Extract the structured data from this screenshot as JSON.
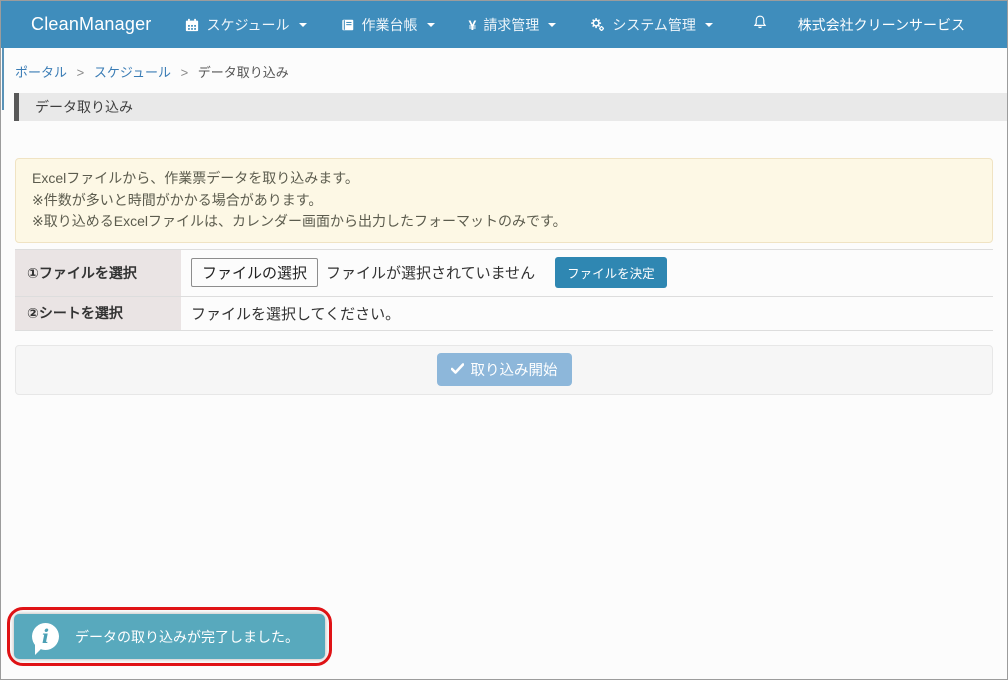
{
  "navbar": {
    "brand": "CleanManager",
    "menus": [
      {
        "label": "スケジュール",
        "icon": "calendar-icon"
      },
      {
        "label": "作業台帳",
        "icon": "book-icon"
      },
      {
        "label": "請求管理",
        "icon": "yen-icon",
        "yen": "¥"
      },
      {
        "label": "システム管理",
        "icon": "gears-icon"
      }
    ],
    "company": "株式会社クリーンサービス",
    "bg_color": "#3f8dbc"
  },
  "breadcrumb": {
    "separator": ">",
    "items": [
      {
        "label": "ポータル"
      },
      {
        "label": "スケジュール"
      },
      {
        "label": "データ取り込み"
      }
    ]
  },
  "page_title": "データ取り込み",
  "notice": {
    "lines": [
      "Excelファイルから、作業票データを取り込みます。",
      "※件数が多いと時間がかかる場合があります。",
      "※取り込めるExcelファイルは、カレンダー画面から出力したフォーマットのみです。"
    ],
    "bg_color": "#fdf8e5"
  },
  "form": {
    "rows": [
      {
        "label": "①ファイルを選択",
        "file_button": "ファイルの選択",
        "file_status": "ファイルが選択されていません",
        "action_button": "ファイルを決定",
        "action_color": "#2f87b2"
      },
      {
        "label": "②シートを選択",
        "text": "ファイルを選択してください。"
      }
    ]
  },
  "submit": {
    "label": "取り込み開始",
    "icon": "check-icon",
    "color": "#8db7da"
  },
  "toast": {
    "message": "データの取り込みが完了しました。",
    "icon": "info-icon",
    "bg_color": "#58a9bd",
    "annotation_color": "#e01316"
  }
}
